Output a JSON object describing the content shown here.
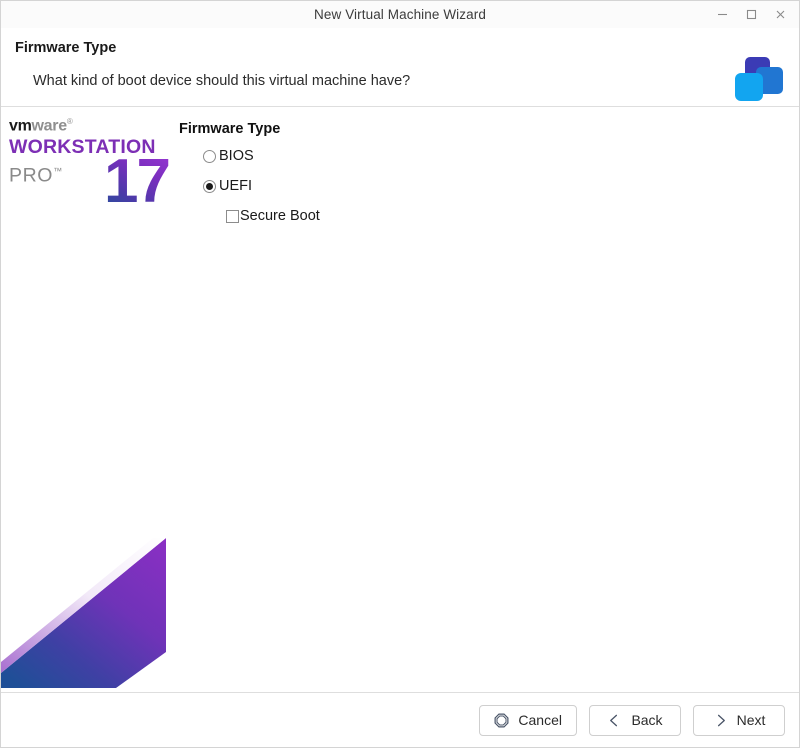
{
  "window": {
    "title": "New Virtual Machine Wizard",
    "controls": {
      "minimize_label": "–",
      "maximize_label": "□",
      "close_label": "×"
    }
  },
  "header": {
    "title": "Firmware Type",
    "subtitle": "What kind of boot device should this virtual machine have?",
    "logo_icon": "vmware-cubes-icon",
    "logo_colors": {
      "dark_blue": "#3b3bb5",
      "mid_blue": "#2176d2",
      "light_blue": "#12a5f0"
    }
  },
  "branding": {
    "vm": "vm",
    "ware": "ware",
    "registered": "®",
    "product": "WORKSTATION",
    "edition": "PRO",
    "trademark": "™",
    "version": "17",
    "accent_purple": "#7d2fb5",
    "gradient_from": "#9a37d4",
    "gradient_to": "#22539b"
  },
  "decoration": {
    "ribbon_icon": "gradient-parallelogram-decoration",
    "gradient_from": "#7a2fbe",
    "gradient_to": "#22539b"
  },
  "form": {
    "legend": "Firmware Type",
    "options": [
      {
        "label": "BIOS",
        "selected": false,
        "name": "radio-bios"
      },
      {
        "label": "UEFI",
        "selected": true,
        "name": "radio-uefi"
      }
    ],
    "secure_boot": {
      "label": "Secure Boot",
      "checked": false
    }
  },
  "footer": {
    "buttons": [
      {
        "label": "Cancel",
        "icon": "octagon-stop-icon",
        "name": "cancel-button"
      },
      {
        "label": "Back",
        "icon": "chevron-left-icon",
        "name": "back-button"
      },
      {
        "label": "Next",
        "icon": "chevron-right-icon",
        "name": "next-button"
      }
    ]
  }
}
